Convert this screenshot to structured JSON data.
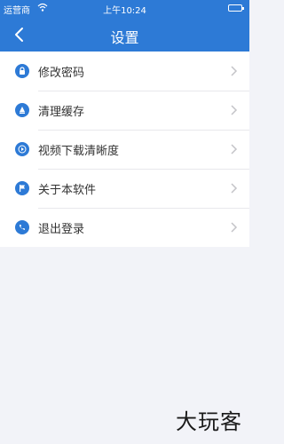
{
  "status_bar": {
    "carrier": "运营商",
    "time": "上午10:24"
  },
  "nav": {
    "title": "设置",
    "back_icon": "chevron-left-icon"
  },
  "menu": {
    "items": [
      {
        "label": "修改密码",
        "icon": "lock-icon"
      },
      {
        "label": "清理缓存",
        "icon": "broom-icon"
      },
      {
        "label": "视频下载清晰度",
        "icon": "play-icon"
      },
      {
        "label": "关于本软件",
        "icon": "flag-icon"
      },
      {
        "label": "退出登录",
        "icon": "phone-icon"
      }
    ]
  },
  "watermark": "大玩客",
  "colors": {
    "accent": "#2d7ad6",
    "background": "#f2f3f8"
  }
}
